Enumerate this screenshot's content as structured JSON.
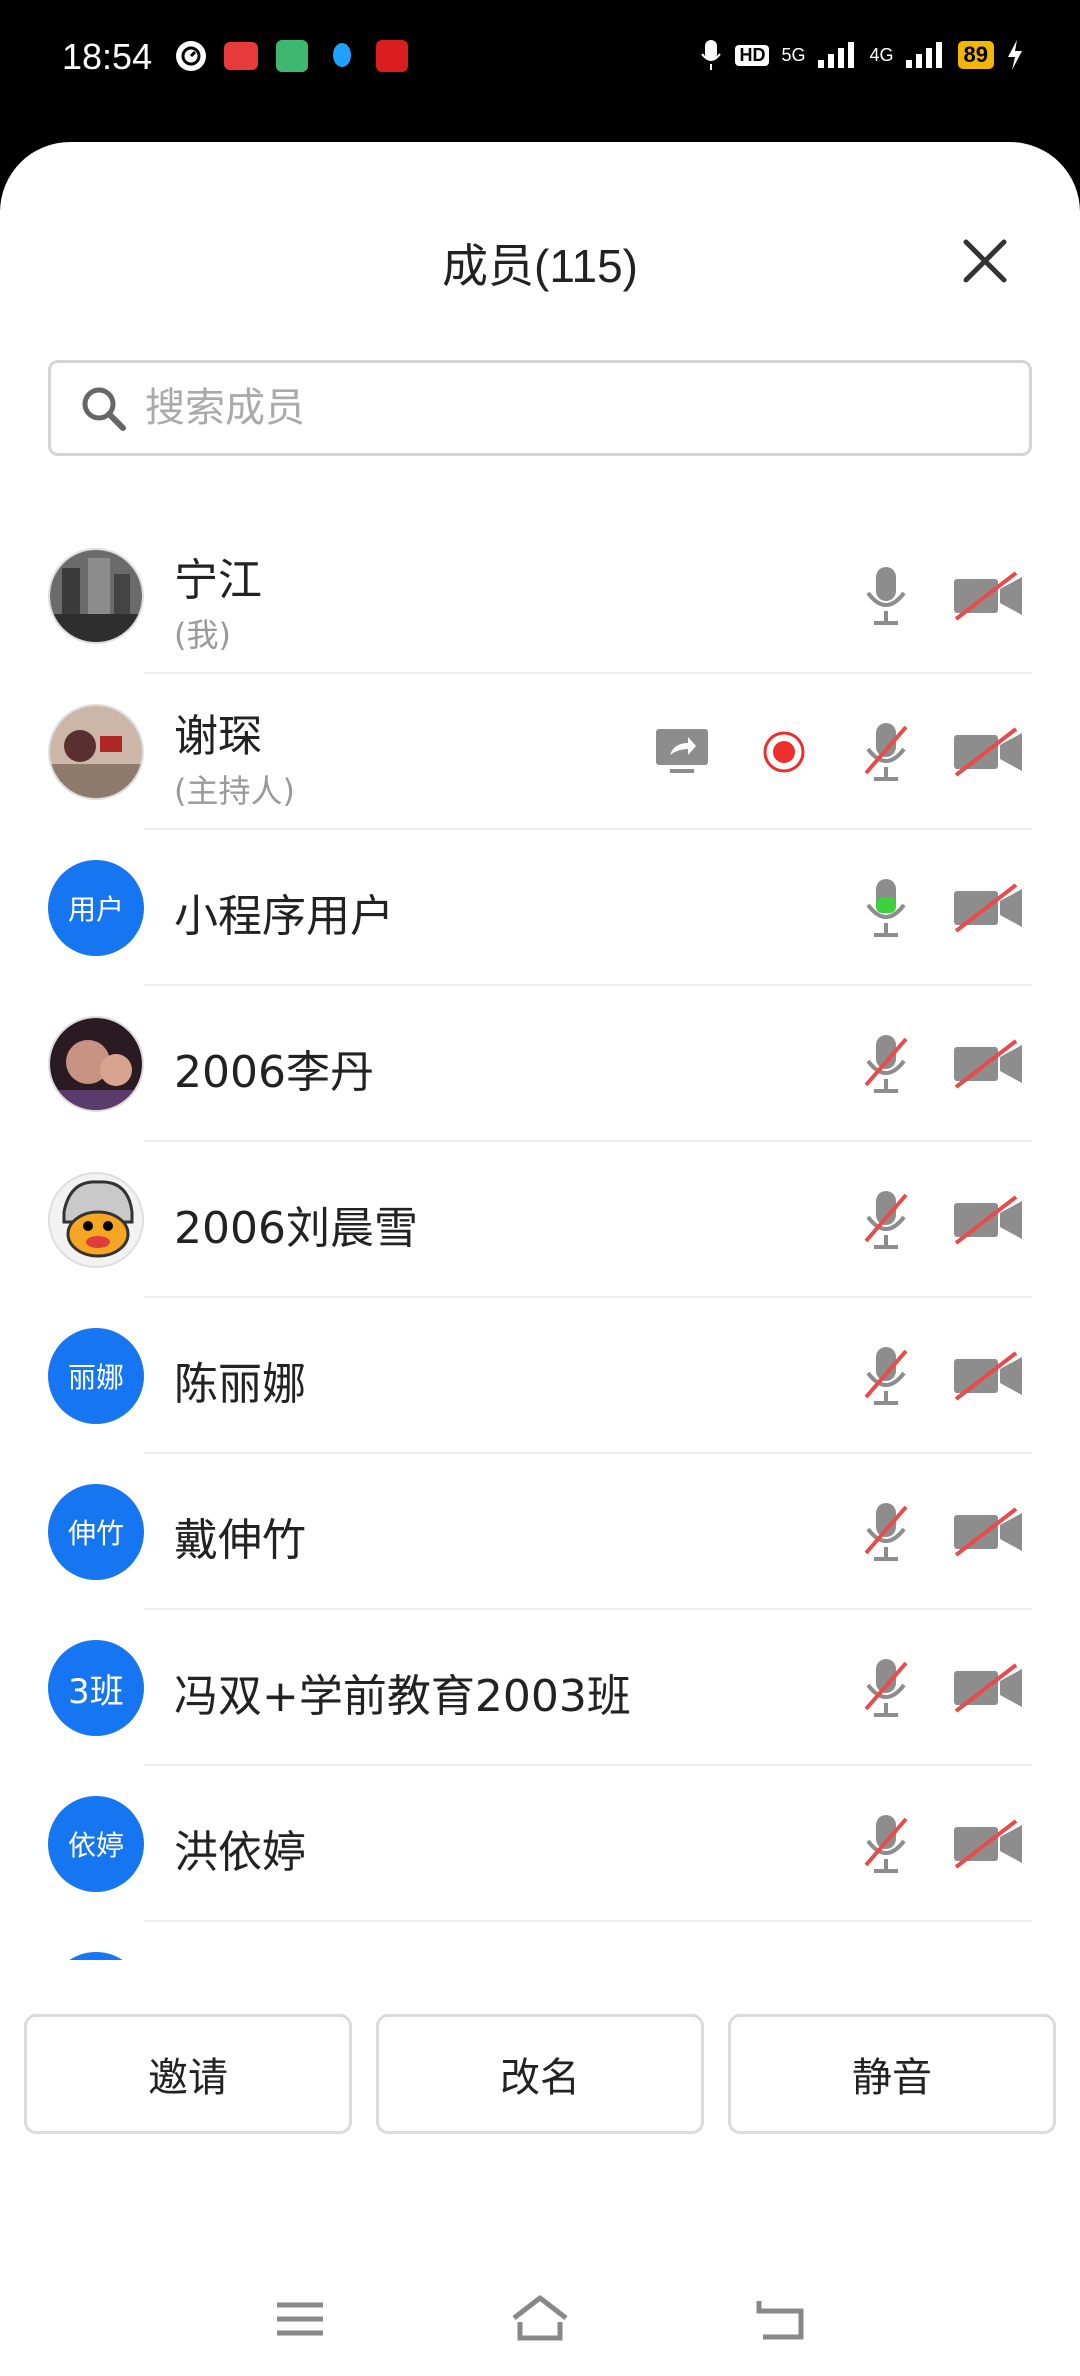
{
  "status_bar": {
    "time": "18:54",
    "battery": "89",
    "network_5g": "5G",
    "network_4g": "4G",
    "hd": "HD"
  },
  "header": {
    "title": "成员(115)"
  },
  "search": {
    "placeholder": "搜索成员",
    "value": ""
  },
  "members": [
    {
      "name": "宁江",
      "sub": "(我)",
      "avatar": "photo",
      "mic": "on",
      "camera": "off"
    },
    {
      "name": "谢琛",
      "sub": "(主持人)",
      "avatar": "photo",
      "mic": "muted",
      "camera": "off",
      "screen_share": true,
      "recording": true
    },
    {
      "name": "小程序用户",
      "avatar_text": "用户",
      "mic": "speaking",
      "camera": "off"
    },
    {
      "name": "2006李丹",
      "avatar": "photo",
      "mic": "muted",
      "camera": "off"
    },
    {
      "name": "2006刘晨雪",
      "avatar": "photo",
      "mic": "muted",
      "camera": "off"
    },
    {
      "name": "陈丽娜",
      "avatar_text": "丽娜",
      "mic": "muted",
      "camera": "off"
    },
    {
      "name": "戴伸竹",
      "avatar_text": "伸竹",
      "mic": "muted",
      "camera": "off"
    },
    {
      "name": "冯双+学前教育2003班",
      "avatar_text": "3班",
      "mic": "muted",
      "camera": "off"
    },
    {
      "name": "洪依婷",
      "avatar_text": "依婷",
      "mic": "muted",
      "camera": "off"
    }
  ],
  "actions": {
    "invite": "邀请",
    "rename": "改名",
    "mute": "静音"
  },
  "colors": {
    "accent": "#1675f0",
    "muted_slash": "#e84b4b",
    "speaking": "#3dd13d",
    "recording": "#ee2d2d"
  }
}
